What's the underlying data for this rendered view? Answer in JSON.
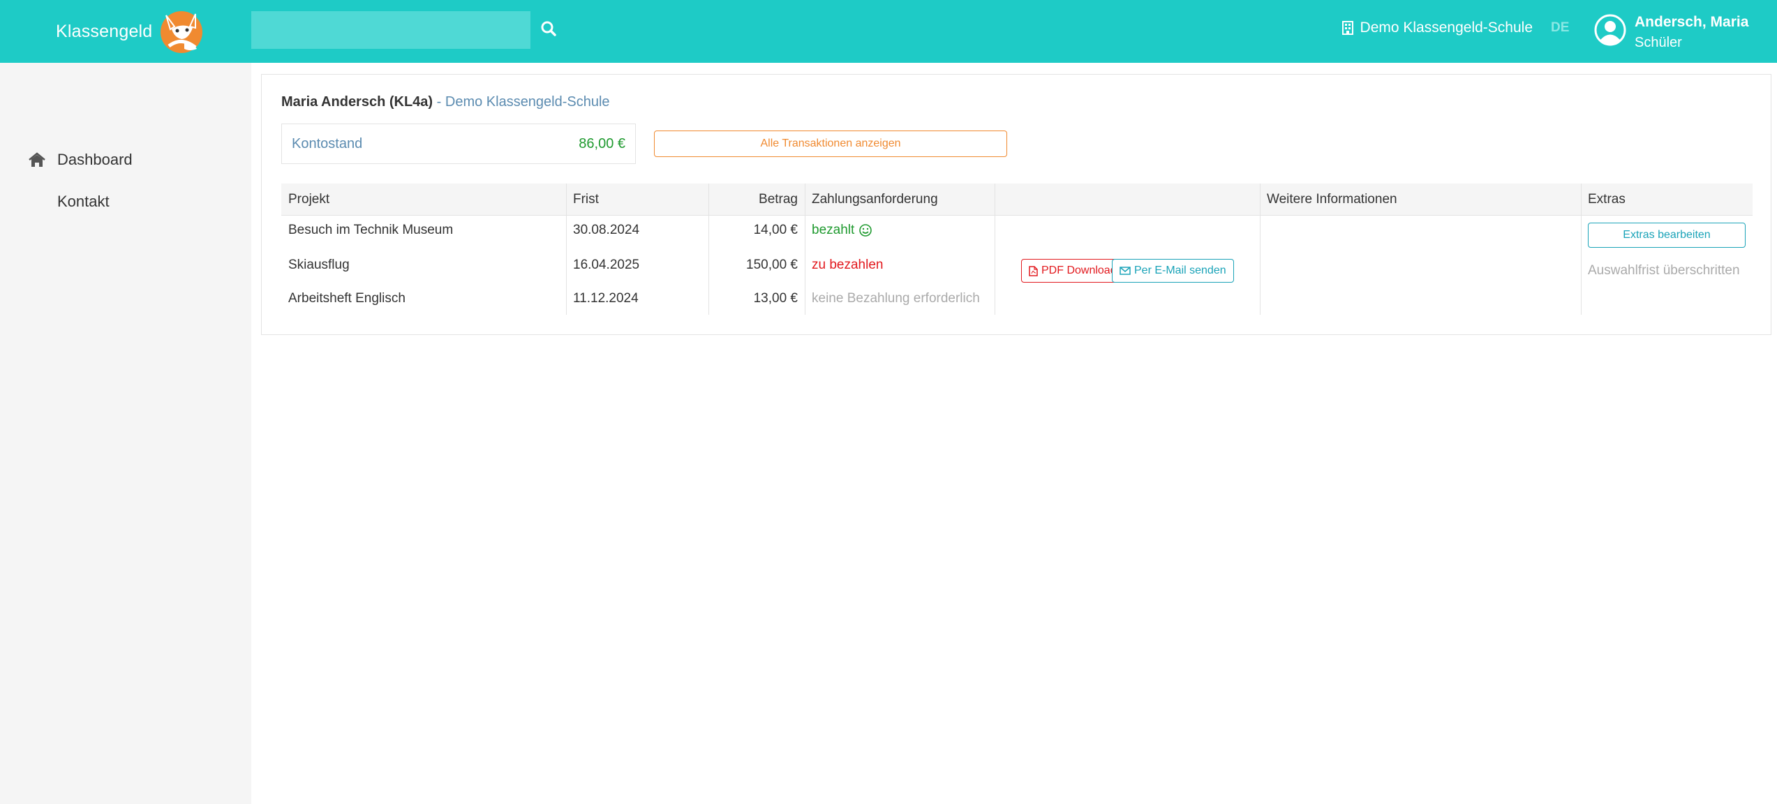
{
  "header": {
    "brand": "Klassengeld",
    "search": {
      "placeholder": "",
      "value": ""
    },
    "school": "Demo Klassengeld-Schule",
    "language": "DE",
    "user": {
      "name": "Andersch, Maria",
      "role": "Schüler"
    }
  },
  "sidebar": {
    "items": [
      {
        "label": "Dashboard",
        "icon": "home-icon"
      },
      {
        "label": "Kontakt"
      }
    ]
  },
  "main": {
    "student": "Maria Andersch (KL4a)",
    "separator": " - ",
    "school": "Demo Klassengeld-Schule",
    "balance": {
      "label": "Kontostand",
      "value": "86,00 €"
    },
    "all_transactions_label": "Alle Transaktionen anzeigen",
    "table": {
      "headers": [
        "Projekt",
        "Frist",
        "Betrag",
        "Zahlungsanforderung",
        "",
        "Weitere Informationen",
        "Extras"
      ],
      "rows": [
        {
          "project": "Besuch im Technik Museum",
          "deadline": "30.08.2024",
          "amount": "14,00 €",
          "status": "bezahlt",
          "status_icon": "smile-icon"
        },
        {
          "project": "Skiausflug",
          "deadline": "16.04.2025",
          "amount": "150,00 €",
          "status": "zu bezahlen"
        },
        {
          "project": "Arbeitsheft Englisch",
          "deadline": "11.12.2024",
          "amount": "13,00 €",
          "status": "keine Bezahlung erforderlich"
        }
      ],
      "pdf_label": "PDF Download",
      "email_label": "Per E-Mail senden",
      "extras_label": "Extras bearbeiten",
      "extras_expired": "Auswahlfrist überschritten"
    }
  },
  "colors": {
    "topbar": "#1ecbc6",
    "paid": "#1f9a2f",
    "due": "#e2191e",
    "accent_orange": "#f08a30",
    "accent_teal": "#1aa3b8"
  }
}
